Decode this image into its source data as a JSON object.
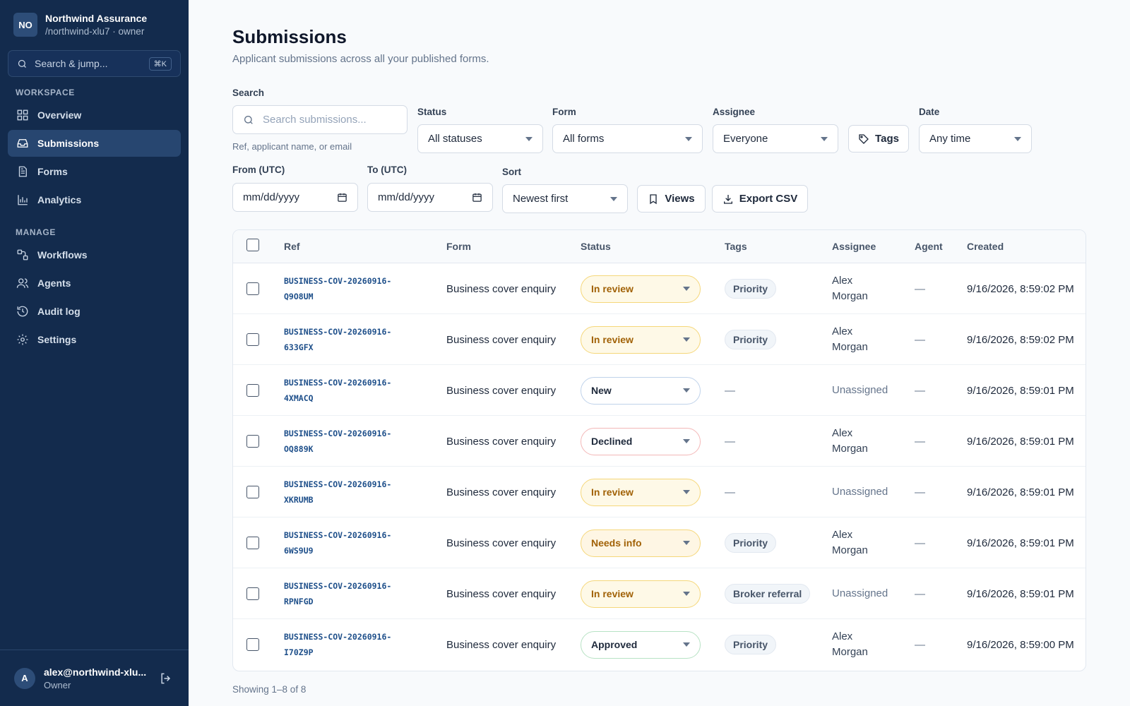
{
  "org": {
    "initials": "NO",
    "name": "Northwind Assurance",
    "sub": "/northwind-xlu7 · owner"
  },
  "jump": {
    "placeholder": "Search & jump...",
    "shortcut": "⌘K"
  },
  "nav": {
    "workspace_label": "WORKSPACE",
    "manage_label": "MANAGE",
    "workspace_items": [
      {
        "label": "Overview",
        "icon": "grid-icon"
      },
      {
        "label": "Submissions",
        "icon": "inbox-icon",
        "active": true
      },
      {
        "label": "Forms",
        "icon": "document-icon"
      },
      {
        "label": "Analytics",
        "icon": "bar-chart-icon"
      }
    ],
    "manage_items": [
      {
        "label": "Workflows",
        "icon": "workflow-icon"
      },
      {
        "label": "Agents",
        "icon": "users-icon"
      },
      {
        "label": "Audit log",
        "icon": "history-icon"
      },
      {
        "label": "Settings",
        "icon": "gear-icon"
      }
    ]
  },
  "user": {
    "initial": "A",
    "email": "alex@northwind-xlu...",
    "role": "Owner"
  },
  "page": {
    "title": "Submissions",
    "subtitle": "Applicant submissions across all your published forms."
  },
  "filters": {
    "search_label": "Search",
    "search_placeholder": "Search submissions...",
    "search_hint": "Ref, applicant name, or email",
    "status_label": "Status",
    "status_value": "All statuses",
    "form_label": "Form",
    "form_value": "All forms",
    "assignee_label": "Assignee",
    "assignee_value": "Everyone",
    "tags_button": "Tags",
    "date_label": "Date",
    "date_value": "Any time",
    "from_label": "From (UTC)",
    "from_value": "mm/dd/yyyy",
    "to_label": "To (UTC)",
    "to_value": "mm/dd/yyyy",
    "sort_label": "Sort",
    "sort_value": "Newest first",
    "views_button": "Views",
    "export_button": "Export CSV"
  },
  "table": {
    "headers": {
      "ref": "Ref",
      "form": "Form",
      "status": "Status",
      "tags": "Tags",
      "assignee": "Assignee",
      "agent": "Agent",
      "created": "Created"
    },
    "rows": [
      {
        "ref1": "BUSINESS-COV-20260916-",
        "ref2": "Q9O8UM",
        "form": "Business cover enquiry",
        "status": "In review",
        "tag": "Priority",
        "assignee1": "Alex",
        "assignee2": "Morgan",
        "agent": "—",
        "created": "9/16/2026, 8:59:02 PM"
      },
      {
        "ref1": "BUSINESS-COV-20260916-",
        "ref2": "633GFX",
        "form": "Business cover enquiry",
        "status": "In review",
        "tag": "Priority",
        "assignee1": "Alex",
        "assignee2": "Morgan",
        "agent": "—",
        "created": "9/16/2026, 8:59:02 PM"
      },
      {
        "ref1": "BUSINESS-COV-20260916-",
        "ref2": "4XMACQ",
        "form": "Business cover enquiry",
        "status": "New",
        "tag": "—",
        "assignee1": "Unassigned",
        "assignee2": "",
        "agent": "—",
        "created": "9/16/2026, 8:59:01 PM"
      },
      {
        "ref1": "BUSINESS-COV-20260916-",
        "ref2": "OQ889K",
        "form": "Business cover enquiry",
        "status": "Declined",
        "tag": "—",
        "assignee1": "Alex",
        "assignee2": "Morgan",
        "agent": "—",
        "created": "9/16/2026, 8:59:01 PM"
      },
      {
        "ref1": "BUSINESS-COV-20260916-",
        "ref2": "XKRUMB",
        "form": "Business cover enquiry",
        "status": "In review",
        "tag": "—",
        "assignee1": "Unassigned",
        "assignee2": "",
        "agent": "—",
        "created": "9/16/2026, 8:59:01 PM"
      },
      {
        "ref1": "BUSINESS-COV-20260916-",
        "ref2": "6WS9U9",
        "form": "Business cover enquiry",
        "status": "Needs info",
        "tag": "Priority",
        "assignee1": "Alex",
        "assignee2": "Morgan",
        "agent": "—",
        "created": "9/16/2026, 8:59:01 PM"
      },
      {
        "ref1": "BUSINESS-COV-20260916-",
        "ref2": "RPNFGD",
        "form": "Business cover enquiry",
        "status": "In review",
        "tag": "Broker referral",
        "assignee1": "Unassigned",
        "assignee2": "",
        "agent": "—",
        "created": "9/16/2026, 8:59:01 PM"
      },
      {
        "ref1": "BUSINESS-COV-20260916-",
        "ref2": "I70Z9P",
        "form": "Business cover enquiry",
        "status": "Approved",
        "tag": "Priority",
        "assignee1": "Alex",
        "assignee2": "Morgan",
        "agent": "—",
        "created": "9/16/2026, 8:59:00 PM"
      }
    ]
  },
  "status_colors": {
    "In review": {
      "bg": "#fef9e7",
      "border": "#f5d77a",
      "text": "#a16207"
    },
    "New": {
      "bg": "#ffffff",
      "border": "#bfd2ea",
      "text": "#1e293b"
    },
    "Declined": {
      "bg": "#ffffff",
      "border": "#f3b7b7",
      "text": "#1e293b"
    },
    "Needs info": {
      "bg": "#fef6e4",
      "border": "#f5d77a",
      "text": "#a16207"
    },
    "Approved": {
      "bg": "#ffffff",
      "border": "#b7e2c4",
      "text": "#1e293b"
    }
  },
  "footer": {
    "count": "Showing 1–8 of 8"
  }
}
